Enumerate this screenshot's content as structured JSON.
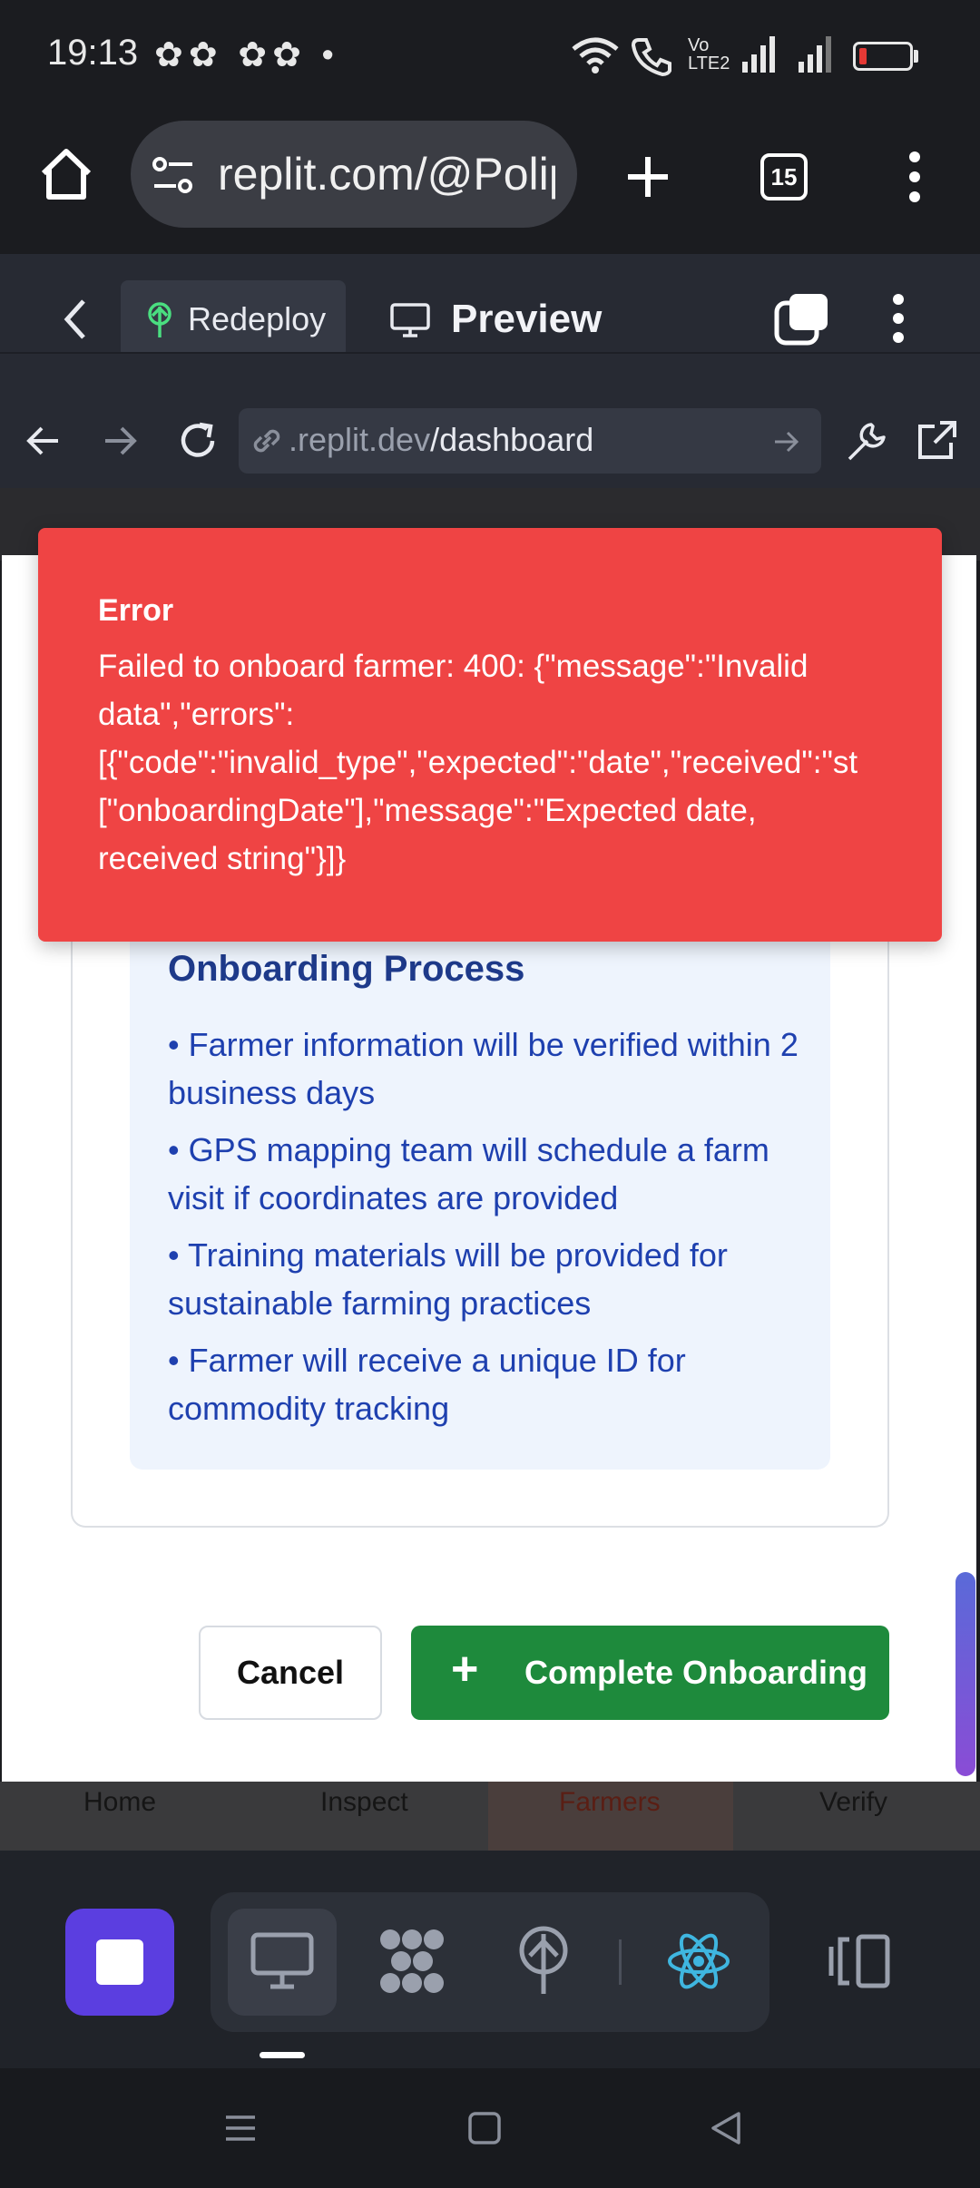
{
  "status_bar": {
    "time": "19:13",
    "notification_glyphs": "✿✿ ✿✿ •",
    "network": "Vo LTE2"
  },
  "browser": {
    "url": "replit.com/@Polip",
    "tab_count": "15"
  },
  "replit_header": {
    "redeploy_label": "Redeploy",
    "preview_label": "Preview"
  },
  "preview_nav": {
    "address_prefix": ".replit.dev",
    "address_path": "/dashboard"
  },
  "toast": {
    "title": "Error",
    "lines": [
      "Failed to onboard farmer: 400: {\"message\":\"Invalid",
      "data\",\"errors\":",
      "[{\"code\":\"invalid_type\",\"expected\":\"date\",\"received\":\"st",
      "[\"onboardingDate\"],\"message\":\"Expected date,",
      "received string\"}]}"
    ],
    "color": "#ef4444"
  },
  "onboarding": {
    "title": "Onboarding Process",
    "items": [
      "• Farmer information will be verified within 2 business days",
      "• GPS mapping team will schedule a farm visit if coordinates are provided",
      "• Training materials will be provided for sustainable farming practices",
      "• Farmer will receive a unique ID for commodity tracking"
    ]
  },
  "actions": {
    "cancel_label": "Cancel",
    "complete_label": "Complete Onboarding",
    "complete_icon": "+",
    "complete_color": "#1e8a3c"
  },
  "app_tabs": {
    "items": [
      "Home",
      "Inspect",
      "Farmers",
      "Verify"
    ],
    "active": "Farmers"
  },
  "colors": {
    "accent": "#5b3ee0",
    "react_icon": "#3fb6e0"
  }
}
